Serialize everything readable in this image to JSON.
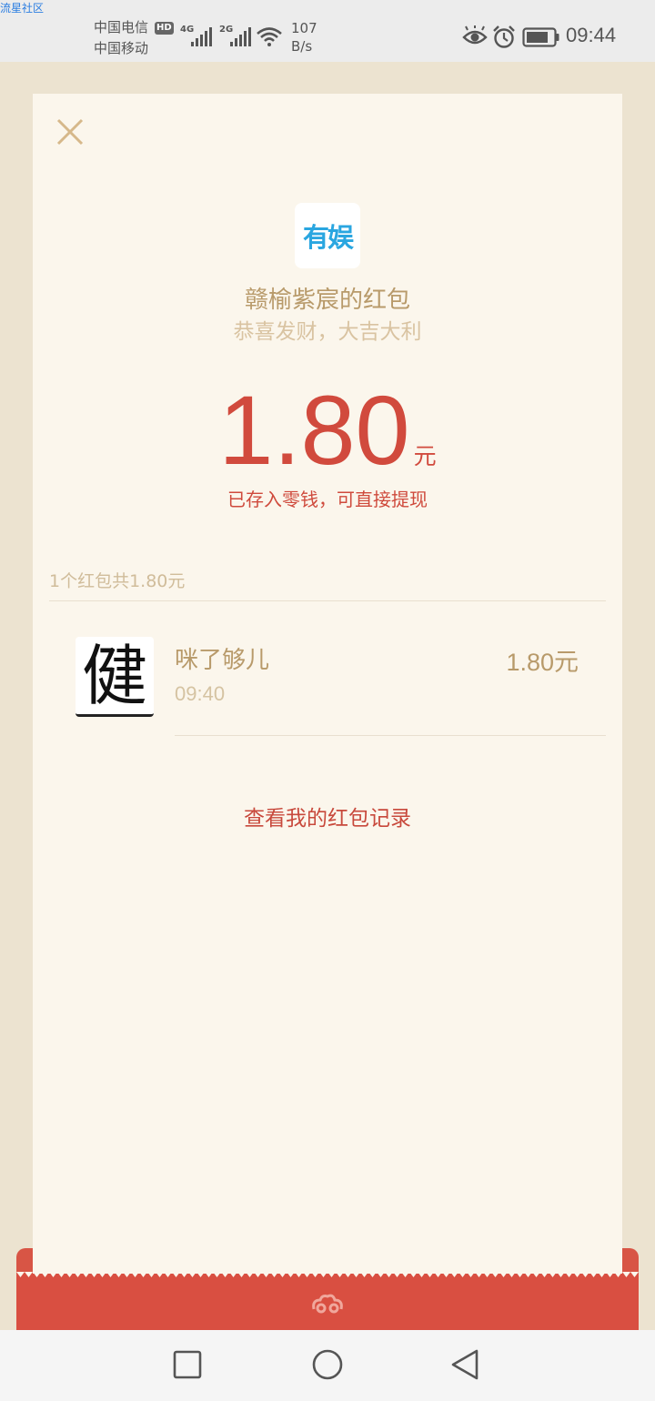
{
  "watermark": "流星社区",
  "status_bar": {
    "carrier_1": "中国电信",
    "carrier_2": "中国移动",
    "hd": "HD",
    "net_1": "4G",
    "net_2": "2G",
    "speed_value": "107",
    "speed_unit": "B/s",
    "time": "09:44",
    "icons": [
      "eye-icon",
      "alarm-icon",
      "battery-icon",
      "wifi-icon",
      "signal-icon"
    ]
  },
  "red_packet": {
    "logo_text": "有娱",
    "sender_title": "赣榆紫宸的红包",
    "greeting": "恭喜发财，大吉大利",
    "amount": "1.80",
    "unit": "元",
    "saved_note": "已存入零钱，可直接提现",
    "summary": "1个红包共1.80元",
    "receivers": [
      {
        "avatar_char": "健",
        "name": "咪了够儿",
        "time": "09:40",
        "amount": "1.80元"
      }
    ],
    "history_link": "查看我的红包记录"
  },
  "colors": {
    "accent_red": "#d14a3d",
    "gold": "#b89a6a",
    "card_bg": "#fbf6ec"
  }
}
